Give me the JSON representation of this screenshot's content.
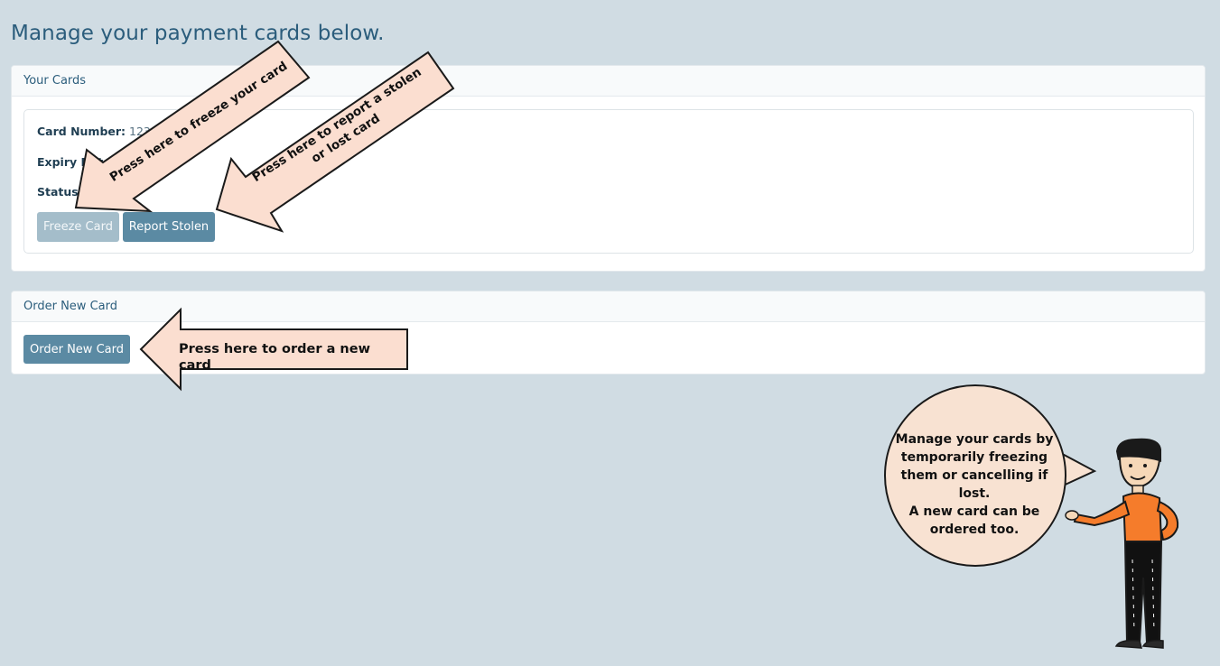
{
  "page": {
    "title": "Manage your payment cards below."
  },
  "your_cards": {
    "header": "Your Cards",
    "card_number_label": "Card Number:",
    "card_number_value": "12345",
    "expiry_label": "Expiry Date:",
    "status_label": "Status:",
    "freeze_button": "Freeze Card",
    "report_button": "Report Stolen"
  },
  "order_card": {
    "header": "Order New Card",
    "order_button": "Order New Card"
  },
  "annotations": {
    "freeze_callout": "Press here to freeze your card",
    "report_callout": "Press here to report a stolen or lost card",
    "order_callout": "Press here to order a new card",
    "speech_bubble_line1": "Manage your cards by temporarily freezing them or cancelling if lost.",
    "speech_bubble_line2": "A new card can be ordered too."
  },
  "colors": {
    "background": "#d0dce3",
    "title": "#2b5d7c",
    "primary_button": "#5b8aa3",
    "disabled_button": "#a4bdca",
    "callout_fill": "#fbded0",
    "bubble_fill": "#f8e2d2",
    "shirt": "#f57c2b"
  }
}
